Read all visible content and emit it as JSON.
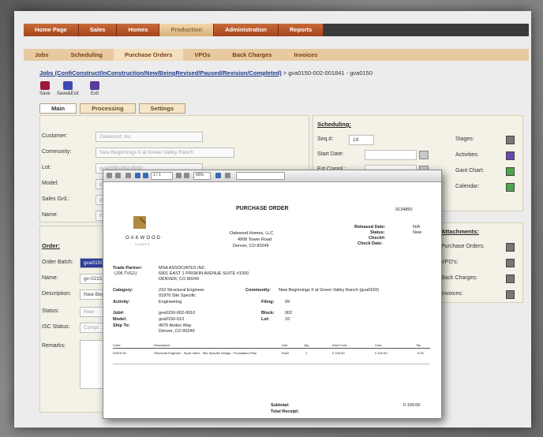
{
  "nav": {
    "tabs": [
      {
        "label": "Home Page"
      },
      {
        "label": "Sales"
      },
      {
        "label": "Homes"
      },
      {
        "label": "Production"
      },
      {
        "label": "Administration"
      },
      {
        "label": "Reports"
      }
    ],
    "active_index": 3,
    "subtabs": [
      {
        "label": "Jobs"
      },
      {
        "label": "Scheduling"
      },
      {
        "label": "Purchase Orders"
      },
      {
        "label": "VPOs"
      },
      {
        "label": "Back Charges"
      },
      {
        "label": "Invoices"
      }
    ],
    "sub_active_index": 2
  },
  "breadcrumb": {
    "link": "Jobs (ConfiConstruct/InConstruction/New/BeingRevised/Paused/Revision/Completed)",
    "rest": "> gva0150-002-001841 - gva0150"
  },
  "toolbar": {
    "save_label": "Save",
    "save_exit_label": "Save&Exit",
    "exit_label": "Exit"
  },
  "form_tabs": [
    "Main",
    "Processing",
    "Settings"
  ],
  "left_panel": {
    "labels": [
      "Customer:",
      "Community:",
      "Lot:",
      "Model:",
      "Sales Grd.:",
      "Name:"
    ],
    "values": [
      "Oakwood, Inc.",
      "New Beginnings II at Green Valley Ranch",
      "gva0150-002-0010",
      "gva0150-013",
      "gva01...",
      "Ken M..."
    ]
  },
  "left_panel2": {
    "section": "Order:",
    "labels": [
      "Order Batch:",
      "Name:",
      "Description:",
      "Status:",
      "ISC Status:",
      "Remarks:"
    ],
    "values": [
      "gva0150-...",
      "gv-0215...",
      "New Begi...",
      "New",
      "Compl...",
      ""
    ]
  },
  "scheduling": {
    "section": "Scheduling:",
    "labels": [
      "Seq.#:",
      "Start Date:",
      "Est.Compl.:"
    ],
    "seq_value": "19",
    "right_labels": [
      "Stages:",
      "Activities:",
      "Gant Chart:",
      "Calendar:"
    ]
  },
  "attachments": {
    "section": "Attachments:",
    "labels": [
      "Purchase Orders:",
      "VPO's:",
      "Back Charges:",
      "Invoices:"
    ]
  },
  "pdf": {
    "toolbar_page": "1 / 1",
    "toolbar_zoom": "66%",
    "title": "PURCHASE ORDER",
    "po_number": "9134850",
    "logo_name": "OAKWOOD",
    "logo_sub": "HOMES",
    "company": [
      "Oakwood Homes, LLC",
      "4908 Tower Road",
      "Denver, CO 80249"
    ],
    "meta_labels": [
      "Released Date:",
      "Status:",
      "Check#:",
      "Check Date:"
    ],
    "meta_values": [
      "N/A",
      "New",
      "",
      ""
    ],
    "trade_partner_label": "Trade Partner:",
    "trade_partner": [
      "MSA ASSOCIATES INC",
      "6901 EAST 1 PRISKIN AVENUE SUITE #1000",
      "DENVER, CO 80249"
    ],
    "job_vendor_label": "(J06 TVG1)",
    "category_label": "Category:",
    "category_value": "210 Structural Engineer",
    "category_sub": "01870 Site Specific",
    "community_label": "Community:",
    "community_value": "New Beginnings II at Green Valley Ranch (gva0150)",
    "activity_label": "Activity:",
    "activity_value": "Engineering",
    "filing_label": "Filing:",
    "filing_value": "09",
    "job_label": "Job#:",
    "job_value": "gva0150-002-0010",
    "block_label": "Block:",
    "block_value": "002",
    "model_label": "Model:",
    "model_value": "gva0150-013",
    "lot_label": "Lot:",
    "lot_value": "10",
    "ship_label": "Ship To:",
    "ship_value": [
      "4970 Andes Way",
      "Denver, CO 80249"
    ],
    "table_headers": [
      "Code",
      "Description",
      "Unit",
      "Qty",
      "Each Cost",
      "Cost",
      "Tax"
    ],
    "table_row": [
      "01870 99",
      "Structural Engineer - Sport Valve - Site Specific Design - Foundation Plan",
      "Each",
      "1",
      "0 100.00",
      "0 100.00",
      "0.00"
    ],
    "subtotal_label": "Subtotal:",
    "subtotal_value": "0 100.00",
    "total_label": "Total Receipt:"
  }
}
